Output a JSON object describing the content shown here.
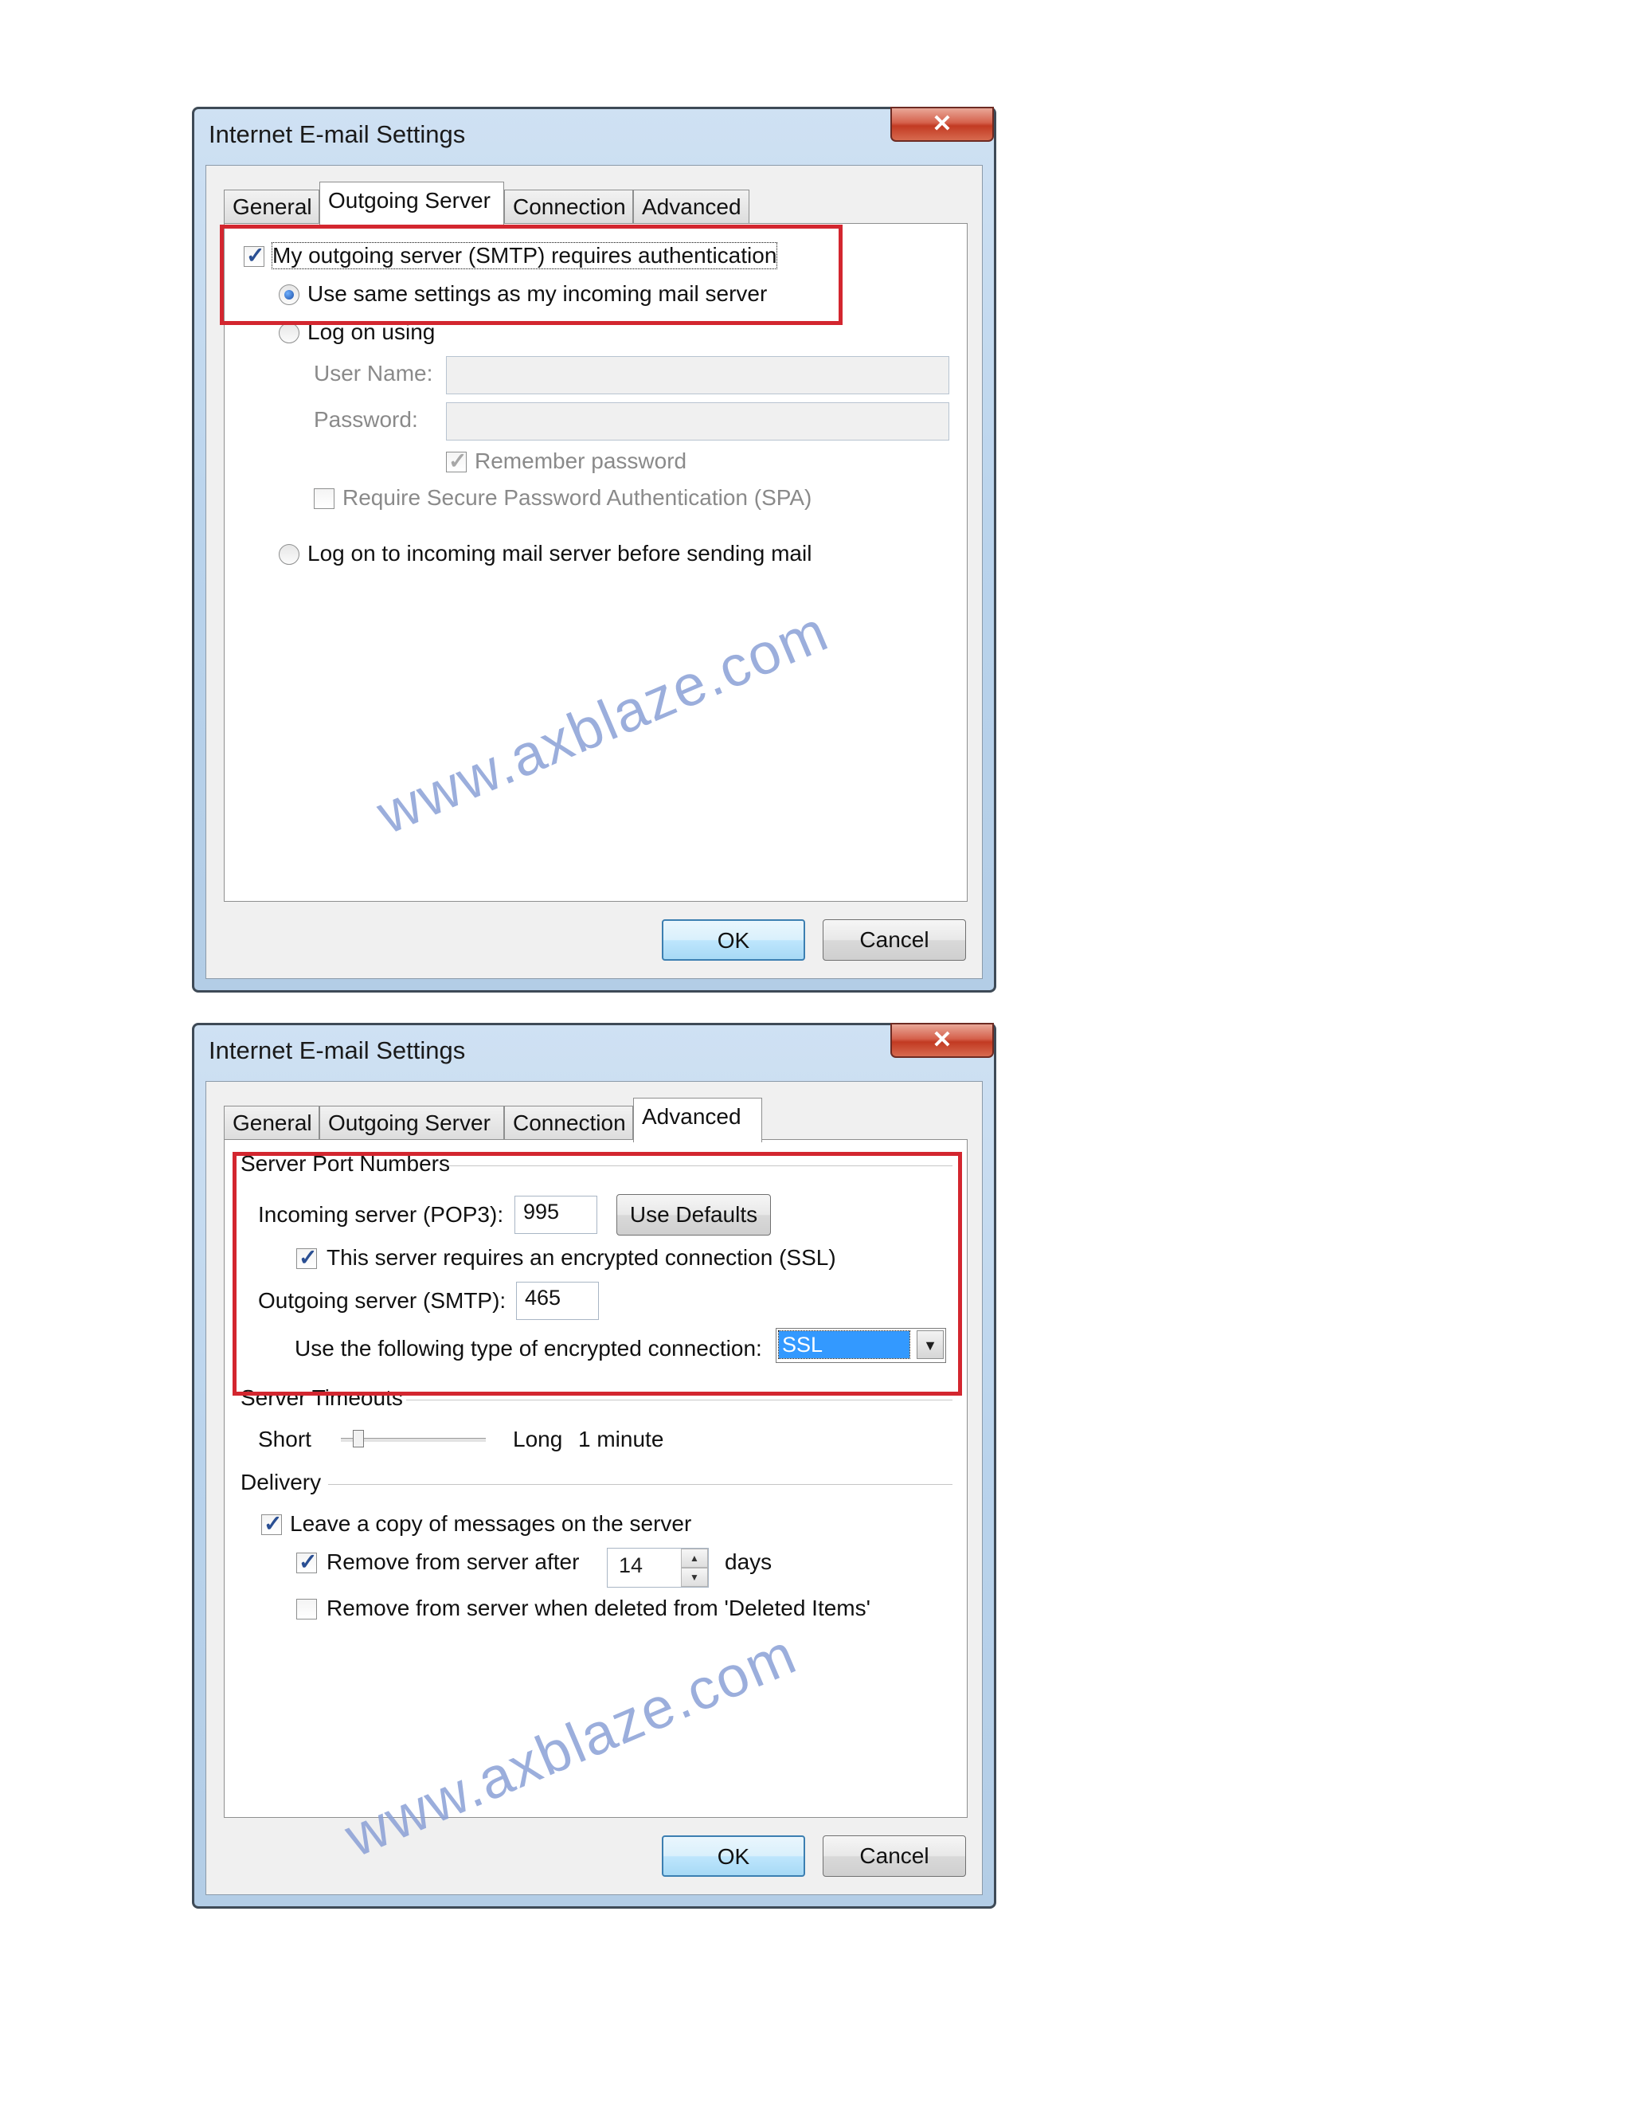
{
  "watermark": "www.axblaze.com",
  "dialog1": {
    "title": "Internet E-mail Settings",
    "close_icon": "x-close-icon",
    "tabs": [
      "General",
      "Outgoing Server",
      "Connection",
      "Advanced"
    ],
    "active_tab": "Outgoing Server",
    "smtp_auth_label": "My outgoing server (SMTP) requires authentication",
    "smtp_auth_checked": true,
    "use_same_label": "Use same settings as my incoming mail server",
    "log_on_using_label": "Log on using",
    "user_name_label": "User Name:",
    "user_name_value": "",
    "password_label": "Password:",
    "password_value": "",
    "remember_password_label": "Remember password",
    "require_spa_label": "Require Secure Password Authentication (SPA)",
    "log_on_incoming_label": "Log on to incoming mail server before sending mail",
    "ok_label": "OK",
    "cancel_label": "Cancel"
  },
  "dialog2": {
    "title": "Internet E-mail Settings",
    "close_icon": "x-close-icon",
    "tabs": [
      "General",
      "Outgoing Server",
      "Connection",
      "Advanced"
    ],
    "active_tab": "Advanced",
    "server_port_numbers_label": "Server Port Numbers",
    "incoming_label": "Incoming server (POP3):",
    "incoming_value": "995",
    "use_defaults_label": "Use Defaults",
    "ssl_required_label": "This server requires an encrypted connection (SSL)",
    "ssl_required_checked": true,
    "outgoing_label": "Outgoing server (SMTP):",
    "outgoing_value": "465",
    "encryption_label": "Use the following type of encrypted connection:",
    "encryption_value": "SSL",
    "server_timeouts_label": "Server Timeouts",
    "short_label": "Short",
    "long_label": "Long",
    "timeout_value": "1 minute",
    "timeout_slider_position": 0.12,
    "delivery_label": "Delivery",
    "leave_copy_label": "Leave a copy of messages on the server",
    "leave_copy_checked": true,
    "remove_after_label": "Remove from server after",
    "remove_after_checked": true,
    "remove_after_days": "14",
    "days_label": "days",
    "remove_deleted_label": "Remove from server when deleted from 'Deleted Items'",
    "remove_deleted_checked": false,
    "ok_label": "OK",
    "cancel_label": "Cancel"
  },
  "colors": {
    "highlight_box": "#d3262f",
    "selection": "#3399ff",
    "close_button": "#c23a22",
    "watermark": "#8aa0d6"
  }
}
